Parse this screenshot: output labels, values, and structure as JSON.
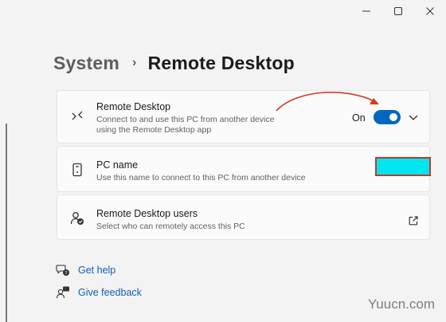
{
  "breadcrumb": {
    "parent": "System",
    "separator": "›",
    "current": "Remote Desktop"
  },
  "cards": {
    "remote_desktop": {
      "title": "Remote Desktop",
      "desc_line1": "Connect to and use this PC from another device",
      "desc_line2": "using the Remote Desktop app",
      "toggle_label": "On",
      "toggle_on": true,
      "icon": "remote-desktop-icon"
    },
    "pc_name": {
      "title": "PC name",
      "desc": "Use this name to connect to this PC from another device",
      "icon": "pc-icon"
    },
    "users": {
      "title": "Remote Desktop users",
      "desc": "Select who can remotely access this PC",
      "icon": "users-icon"
    }
  },
  "links": {
    "help": "Get help",
    "feedback": "Give feedback"
  },
  "watermark": "Yuucn.com",
  "colors": {
    "accent": "#0067c0",
    "annotation": "#d63a1e",
    "redaction": "#00e5ef",
    "link": "#0f5fb5"
  }
}
